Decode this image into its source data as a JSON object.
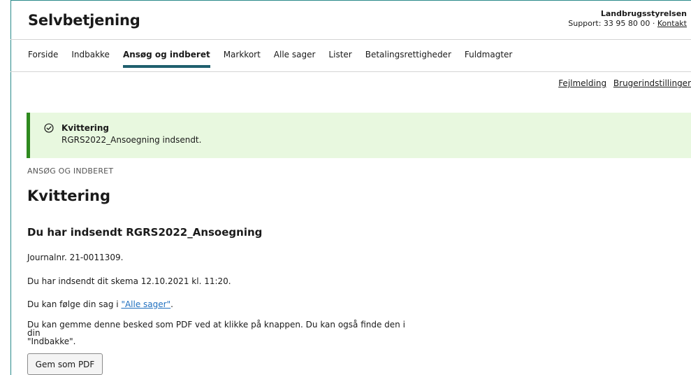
{
  "brand": "Selvbetjening",
  "org": {
    "name": "Landbrugsstyrelsen",
    "support_prefix": "Support: 33 95 80 00 · ",
    "contact_link": "Kontakt"
  },
  "nav": {
    "items": [
      {
        "label": "Forside"
      },
      {
        "label": "Indbakke"
      },
      {
        "label": "Ansøg og indberet",
        "active": true
      },
      {
        "label": "Markkort"
      },
      {
        "label": "Alle sager"
      },
      {
        "label": "Lister"
      },
      {
        "label": "Betalingsrettigheder"
      },
      {
        "label": "Fuldmagter"
      }
    ]
  },
  "utility": {
    "error_report": "Fejlmelding",
    "user_settings": "Brugerindstillinger"
  },
  "alert": {
    "title": "Kvittering",
    "text": "RGRS2022_Ansoegning indsendt.",
    "color": "#2f8a1f",
    "background": "#e8f8df"
  },
  "main": {
    "eyebrow": "ANSØG OG INDBERET",
    "title": "Kvittering",
    "subtitle": "Du har indsendt RGRS2022_Ansoegning",
    "journal": "Journalnr. 21-0011309.",
    "submitted": "Du har indsendt dit skema 12.10.2021 kl. 11:20.",
    "follow_prefix": "Du kan følge din sag i ",
    "follow_link": "\"Alle sager\"",
    "follow_suffix": ".",
    "pdf_line1": "Du kan gemme denne besked som PDF ved at klikke på knappen. Du kan også finde den i din",
    "pdf_line2": "\"Indbakke\".",
    "pdf_button": "Gem som PDF"
  },
  "colors": {
    "accent": "#1f5f6e",
    "link": "#1f6fbf"
  }
}
